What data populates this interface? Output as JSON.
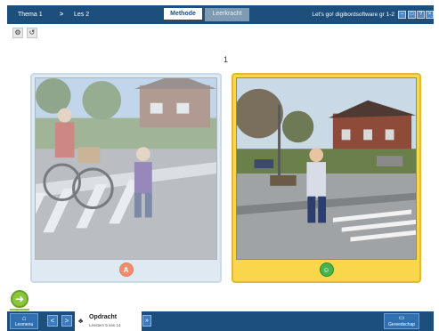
{
  "topbar": {
    "crumb_theme": "Thema 1",
    "crumb_sep": ">",
    "crumb_lesson": "Les 2",
    "tab_methode": "Methode",
    "tab_leerkracht": "Leerkracht",
    "app_title": "Let's go! digibordsoftware gr 1-2"
  },
  "window_controls": {
    "minimize": "–",
    "maximize": "□",
    "help": "?",
    "close": "×"
  },
  "toolbar": {
    "settings_icon": "gear-icon",
    "undo_icon": "undo-icon"
  },
  "page_number": "1",
  "cards": {
    "a": {
      "answer_label": "A",
      "status": "unselected"
    },
    "b": {
      "answer_label": "☺",
      "status": "selected"
    }
  },
  "next_button": {
    "icon": "arrow-right-icon"
  },
  "bottombar": {
    "lesmenu_label": "Lesmenu",
    "prev_label": "<",
    "next_label": ">",
    "task_title": "Opdracht",
    "task_sub": "Lesstem 5 van 14",
    "expand_label": "»",
    "tools_label": "Gereedschap"
  },
  "colors": {
    "accent": "#1d4f7c",
    "selected": "#f9d64a",
    "correct": "#48b24d",
    "wrong": "#f08d6f"
  }
}
